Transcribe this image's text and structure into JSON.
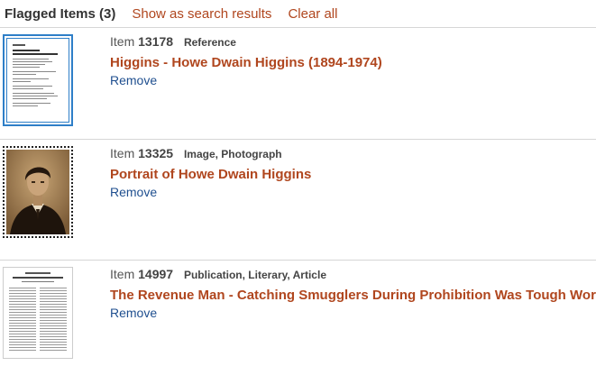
{
  "header": {
    "title": "Flagged Items (3)",
    "show_results": "Show as search results",
    "clear_all": "Clear all"
  },
  "items": [
    {
      "item_label": "Item",
      "item_number": "13178",
      "type": "Reference",
      "title": "Higgins - Howe Dwain Higgins (1894-1974)",
      "remove": "Remove",
      "thumbnail": "document-thumbnail"
    },
    {
      "item_label": "Item",
      "item_number": "13325",
      "type": "Image, Photograph",
      "title": "Portrait of Howe Dwain Higgins",
      "remove": "Remove",
      "thumbnail": "portrait-photo-thumbnail"
    },
    {
      "item_label": "Item",
      "item_number": "14997",
      "type": "Publication, Literary, Article",
      "title": "The Revenue Man - Catching Smugglers During Prohibition Was Tough Work",
      "remove": "Remove",
      "thumbnail": "article-thumbnail"
    }
  ],
  "colors": {
    "link": "#b0461e",
    "remove_link": "#1f4f8f",
    "selected_border": "#2f7fc8"
  }
}
